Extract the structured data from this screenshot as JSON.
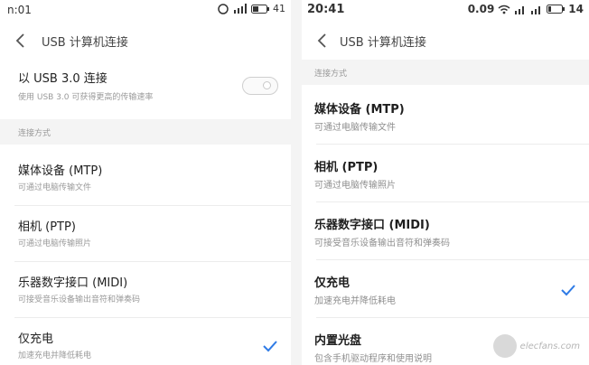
{
  "left": {
    "status": {
      "time": "n:01",
      "battery": "41"
    },
    "title": "USB 计算机连接",
    "toggle_row": {
      "title": "以 USB 3.0 连接",
      "subtitle": "使用 USB 3.0 可获得更高的传输速率"
    },
    "section_label": "连接方式",
    "items": [
      {
        "title": "媒体设备 (MTP)",
        "subtitle": "可通过电脑传输文件"
      },
      {
        "title": "相机 (PTP)",
        "subtitle": "可通过电脑传输照片"
      },
      {
        "title": "乐器数字接口 (MIDI)",
        "subtitle": "可接受音乐设备输出音符和弹奏码"
      },
      {
        "title": "仅充电",
        "subtitle": "加速充电并降低耗电",
        "checked": true
      }
    ]
  },
  "right": {
    "status": {
      "time": "20:41",
      "percent": "0.09",
      "battery": "14"
    },
    "title": "USB 计算机连接",
    "section_label": "连接方式",
    "items": [
      {
        "title": "媒体设备 (MTP)",
        "subtitle": "可通过电脑传输文件"
      },
      {
        "title": "相机 (PTP)",
        "subtitle": "可通过电脑传输照片"
      },
      {
        "title": "乐器数字接口 (MIDI)",
        "subtitle": "可接受音乐设备输出音符和弹奏码"
      },
      {
        "title": "仅充电",
        "subtitle": "加速充电并降低耗电",
        "checked": true
      },
      {
        "title": "内置光盘",
        "subtitle": "包含手机驱动程序和使用说明"
      }
    ]
  },
  "watermark": {
    "text": "elecfans.com"
  },
  "colors": {
    "accent": "#2f7be6",
    "section_bg": "#f4f4f4"
  }
}
